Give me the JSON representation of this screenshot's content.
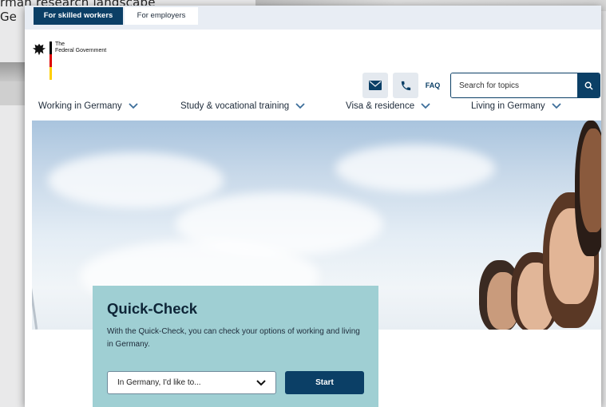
{
  "background": {
    "text_line1": "rman research landscape",
    "text_line2": "Ge"
  },
  "audience_tabs": [
    {
      "label": "For skilled workers",
      "active": true
    },
    {
      "label": "For employers",
      "active": false
    }
  ],
  "logo": {
    "line1": "The",
    "line2": "Federal Government",
    "flag_colors": [
      "#000000",
      "#dd0000",
      "#ffce00"
    ]
  },
  "header_icons": {
    "mail_icon": "envelope-icon",
    "phone_icon": "phone-icon",
    "faq_label": "FAQ"
  },
  "search": {
    "placeholder": "Search for topics",
    "button_icon": "search-icon"
  },
  "nav": [
    {
      "label": "Working in Germany"
    },
    {
      "label": "Study & vocational training"
    },
    {
      "label": "Visa & residence"
    },
    {
      "label": "Living in Germany"
    }
  ],
  "quick_check": {
    "title": "Quick-Check",
    "description": "With the Quick-Check, you can check your options of working and living in Germany.",
    "select_value": "In Germany, I'd like to...",
    "start_label": "Start"
  },
  "colors": {
    "primary": "#0b3f66",
    "card": "#9fcfd3",
    "audience_bar": "#e8edf4"
  }
}
